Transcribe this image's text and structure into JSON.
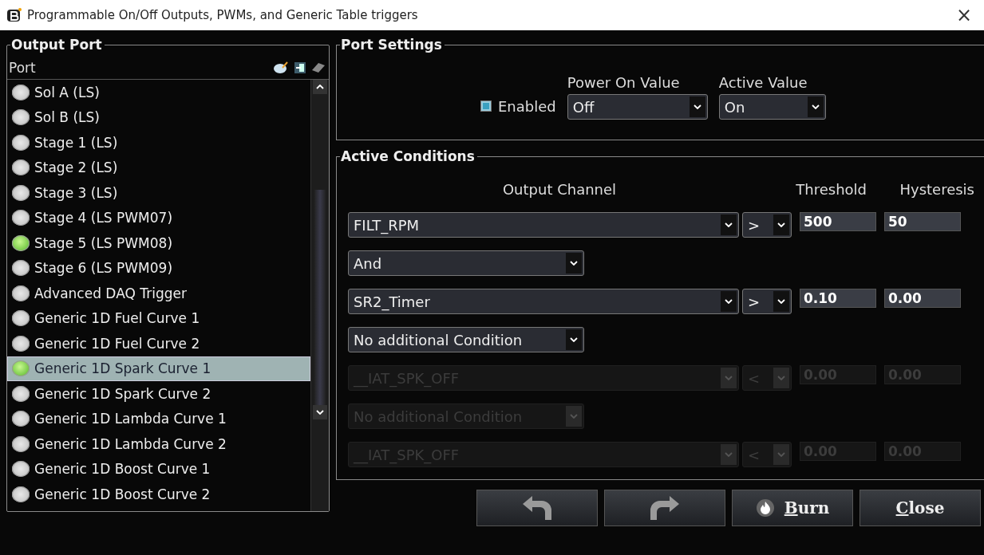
{
  "window": {
    "title": "Programmable On/Off Outputs, PWMs, and Generic Table triggers",
    "close": "×"
  },
  "output_port": {
    "title": "Output Port",
    "column": "Port",
    "items": [
      {
        "label": "Sol A (LS)",
        "on": false,
        "selected": false
      },
      {
        "label": "Sol B (LS)",
        "on": false,
        "selected": false
      },
      {
        "label": "Stage 1 (LS)",
        "on": false,
        "selected": false
      },
      {
        "label": "Stage 2 (LS)",
        "on": false,
        "selected": false
      },
      {
        "label": "Stage 3 (LS)",
        "on": false,
        "selected": false
      },
      {
        "label": "Stage 4 (LS PWM07)",
        "on": false,
        "selected": false
      },
      {
        "label": "Stage 5 (LS PWM08)",
        "on": true,
        "selected": false
      },
      {
        "label": "Stage 6 (LS PWM09)",
        "on": false,
        "selected": false
      },
      {
        "label": "Advanced DAQ Trigger",
        "on": false,
        "selected": false
      },
      {
        "label": "Generic 1D Fuel Curve 1",
        "on": false,
        "selected": false
      },
      {
        "label": "Generic 1D Fuel Curve 2",
        "on": false,
        "selected": false
      },
      {
        "label": "Generic 1D Spark Curve 1",
        "on": true,
        "selected": true
      },
      {
        "label": "Generic 1D Spark Curve 2",
        "on": false,
        "selected": false
      },
      {
        "label": "Generic 1D Lambda Curve 1",
        "on": false,
        "selected": false
      },
      {
        "label": "Generic 1D Lambda Curve 2",
        "on": false,
        "selected": false
      },
      {
        "label": "Generic 1D Boost Curve 1",
        "on": false,
        "selected": false
      },
      {
        "label": "Generic 1D Boost Curve 2",
        "on": false,
        "selected": false
      }
    ]
  },
  "port_settings": {
    "title": "Port Settings",
    "enabled": {
      "label": "Enabled",
      "checked": true
    },
    "power_on_value": {
      "label": "Power On Value",
      "value": "Off"
    },
    "active_value": {
      "label": "Active Value",
      "value": "On"
    }
  },
  "active_conditions": {
    "title": "Active Conditions",
    "headers": {
      "channel": "Output Channel",
      "threshold": "Threshold",
      "hysteresis": "Hysteresis"
    },
    "rows": [
      {
        "kind": "comparison",
        "channel": "FILT_RPM",
        "operator": ">",
        "threshold": "500",
        "hysteresis": "50",
        "disabled": false
      },
      {
        "kind": "logic",
        "value": "And",
        "disabled": false
      },
      {
        "kind": "comparison",
        "channel": "SR2_Timer",
        "operator": ">",
        "threshold": "0.10",
        "hysteresis": "0.00",
        "disabled": false
      },
      {
        "kind": "logic",
        "value": "No additional Condition",
        "disabled": false
      },
      {
        "kind": "comparison",
        "channel": "__IAT_SPK_OFF",
        "operator": "<",
        "threshold": "0.00",
        "hysteresis": "0.00",
        "disabled": true
      },
      {
        "kind": "logic",
        "value": "No additional Condition",
        "disabled": true
      },
      {
        "kind": "comparison",
        "channel": "__IAT_SPK_OFF",
        "operator": "<",
        "threshold": "0.00",
        "hysteresis": "0.00",
        "disabled": true
      }
    ]
  },
  "buttons": [
    {
      "kind": "undo"
    },
    {
      "kind": "redo"
    },
    {
      "kind": "burn",
      "label": "Burn",
      "mnemonic": true
    },
    {
      "kind": "close",
      "label": "Close",
      "mnemonic": true
    }
  ]
}
